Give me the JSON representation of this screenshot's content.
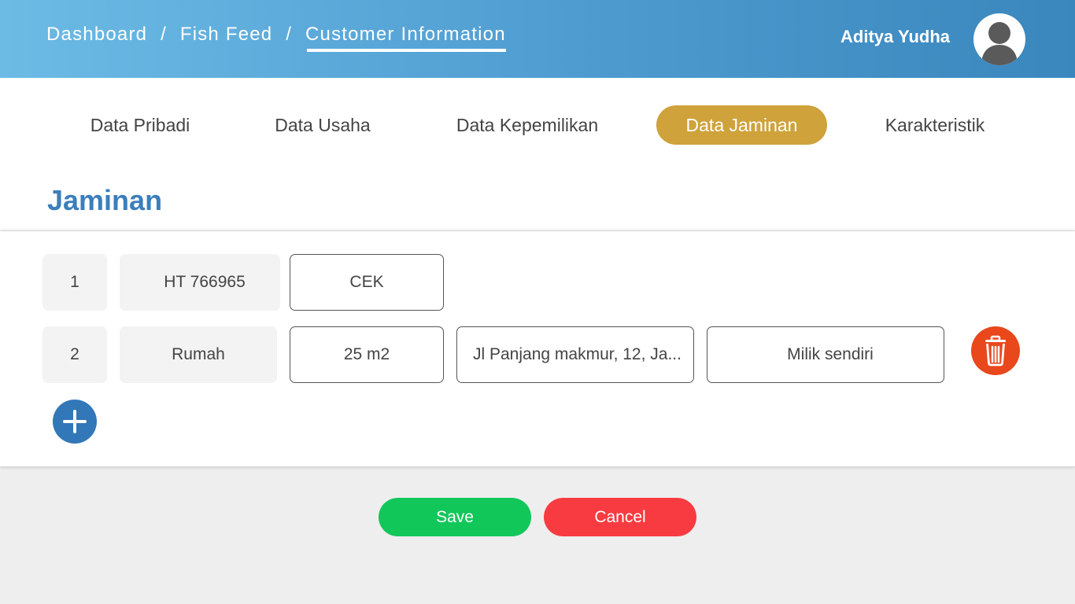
{
  "header": {
    "breadcrumb": [
      "Dashboard",
      "Fish Feed",
      "Customer Information"
    ],
    "separator": "/",
    "user_name": "Aditya Yudha"
  },
  "tabs": [
    {
      "label": "Data Pribadi",
      "active": false
    },
    {
      "label": "Data Usaha",
      "active": false
    },
    {
      "label": "Data Kepemilikan",
      "active": false
    },
    {
      "label": "Data Jaminan",
      "active": true
    },
    {
      "label": "Karakteristik",
      "active": false
    }
  ],
  "section": {
    "title": "Jaminan"
  },
  "rows": [
    {
      "no": "1",
      "type": "HT 766965",
      "value": "CEK"
    },
    {
      "no": "2",
      "type": "Rumah",
      "area": "25 m2",
      "address": "Jl Panjang makmur, 12, Ja...",
      "ownership": "Milik sendiri"
    }
  ],
  "actions": {
    "save": "Save",
    "cancel": "Cancel"
  },
  "icons": {
    "delete": "trash-icon",
    "add": "plus-icon",
    "avatar": "user-avatar-icon"
  },
  "colors": {
    "header_gradient": [
      "#6cbbe5",
      "#3a87bd"
    ],
    "active_tab": "#cfa23b",
    "title": "#3b7fbc",
    "delete": "#e9471c",
    "add": "#3277b8",
    "save": "#12c75a",
    "cancel": "#f73b40"
  }
}
